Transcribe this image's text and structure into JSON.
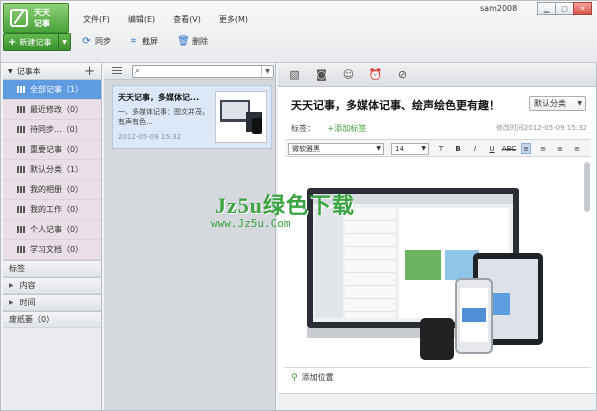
{
  "app": {
    "logo_line1": "天天",
    "logo_line2": "记事",
    "user": "sam2008"
  },
  "menu": [
    "文件(F)",
    "编辑(E)",
    "查看(V)",
    "更多(M)"
  ],
  "toolbar": {
    "new_note": "新建记事",
    "sync": "同步",
    "screenshot": "截屏",
    "delete": "删除"
  },
  "sidebar": {
    "header": "记事本",
    "items": [
      {
        "label": "全部记事（1）"
      },
      {
        "label": "最近修改（0）"
      },
      {
        "label": "待同步...（0）"
      },
      {
        "label": "重要记事（0）"
      },
      {
        "label": "默认分类（1）"
      },
      {
        "label": "我的相册（0）"
      },
      {
        "label": "我的工作（0）"
      },
      {
        "label": "个人记事（0）"
      },
      {
        "label": "学习文档（0）"
      }
    ],
    "sections": {
      "tags": "标签",
      "content": "内容",
      "time": "时间",
      "trash": "废纸篓（0）"
    }
  },
  "notelist": {
    "card": {
      "title": "天天记事，多媒体记...",
      "snippet": "一、多媒体记事：图文并茂，有声有色...",
      "date": "2012-05-09 15:32"
    }
  },
  "editor": {
    "title": "天天记事，多媒体记事、绘声绘色更有趣！",
    "category": "默认分类",
    "tags_label": "标签：",
    "add_tag": "+添加标签",
    "modified": "修改时间2012-05-09 15:32",
    "font": "微软雅黑",
    "size": "14",
    "format_buttons": [
      "B",
      "I",
      "U",
      "U",
      "ABC"
    ],
    "location": "添加位置"
  },
  "watermark": {
    "main": "Jz5u绿色下载",
    "sub": "www.Jz5u.Com"
  }
}
